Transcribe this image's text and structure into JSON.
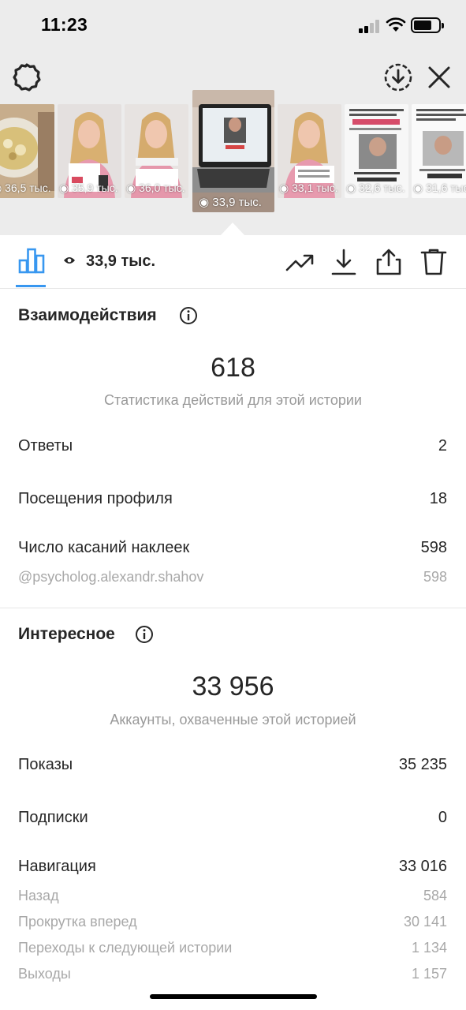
{
  "status_bar": {
    "time": "11:23"
  },
  "thumbnails": [
    {
      "views": "36,5 тыс.",
      "theme": "food"
    },
    {
      "views": "35,9 тыс.",
      "theme": "woman"
    },
    {
      "views": "36,0 тыс.",
      "theme": "woman"
    },
    {
      "views": "33,9 тыс.",
      "theme": "laptop",
      "selected": true
    },
    {
      "views": "33,1 тыс.",
      "theme": "woman"
    },
    {
      "views": "32,6 тыс.",
      "theme": "card"
    },
    {
      "views": "31,6 тыс.",
      "theme": "card"
    }
  ],
  "toolbar": {
    "views": "33,9 тыс."
  },
  "interactions": {
    "title": "Взаимодействия",
    "total": "618",
    "caption": "Статистика действий для этой истории",
    "rows": [
      {
        "label": "Ответы",
        "value": "2"
      },
      {
        "label": "Посещения профиля",
        "value": "18"
      },
      {
        "label": "Число касаний наклеек",
        "value": "598"
      }
    ],
    "sticker": {
      "label": "@psycholog.alexandr.shahov",
      "value": "598"
    }
  },
  "discovery": {
    "title": "Интересное",
    "total": "33 956",
    "caption": "Аккаунты, охваченные этой историей",
    "rows": [
      {
        "label": "Показы",
        "value": "35 235"
      },
      {
        "label": "Подписки",
        "value": "0"
      },
      {
        "label": "Навигация",
        "value": "33 016"
      }
    ],
    "navigation": [
      {
        "label": "Назад",
        "value": "584"
      },
      {
        "label": "Прокрутка вперед",
        "value": "30 141"
      },
      {
        "label": "Переходы к следующей истории",
        "value": "1 134"
      },
      {
        "label": "Выходы",
        "value": "1 157"
      }
    ]
  },
  "colors": {
    "accent": "#3897f0",
    "secondary_text": "#999999",
    "top_bg": "#ececec"
  }
}
